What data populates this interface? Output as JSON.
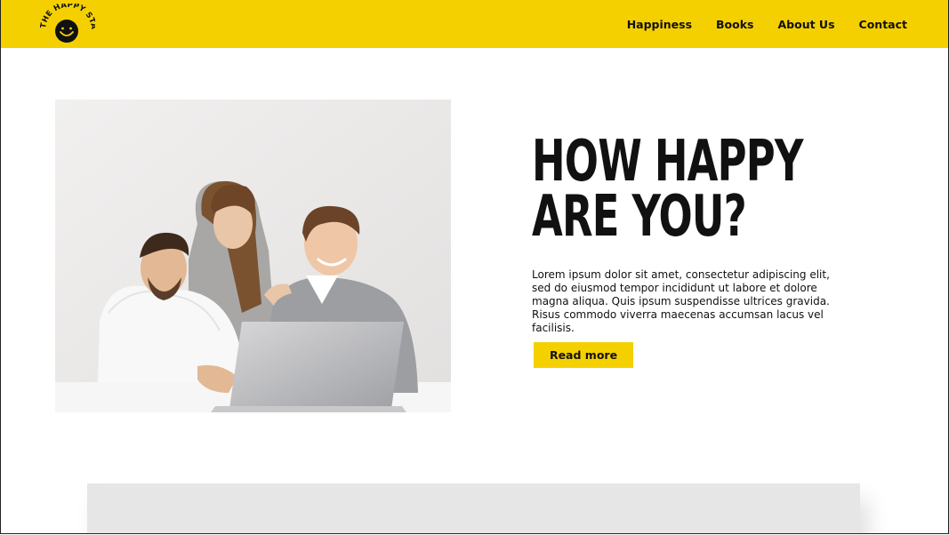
{
  "header": {
    "logo_text": "THE HAPPY STATS",
    "logo_icon": "smiley-icon",
    "nav": [
      "Happiness",
      "Books",
      "About Us",
      "Contact"
    ]
  },
  "hero": {
    "image_alt": "Three smiling colleagues looking at a laptop",
    "title_line1": "HOW HAPPY",
    "title_line2": "ARE YOU?",
    "body": "Lorem ipsum dolor sit amet, consectetur adipiscing elit, sed do eiusmod tempor incididunt ut labore et dolore magna aliqua. Quis ipsum suspendisse ultrices gravida. Risus commodo viverra maecenas accumsan lacus vel facilisis.",
    "button_label": "Read more"
  },
  "colors": {
    "brand_yellow": "#f5d000",
    "text_dark": "#111111",
    "panel_gray": "#e6e6e6"
  }
}
